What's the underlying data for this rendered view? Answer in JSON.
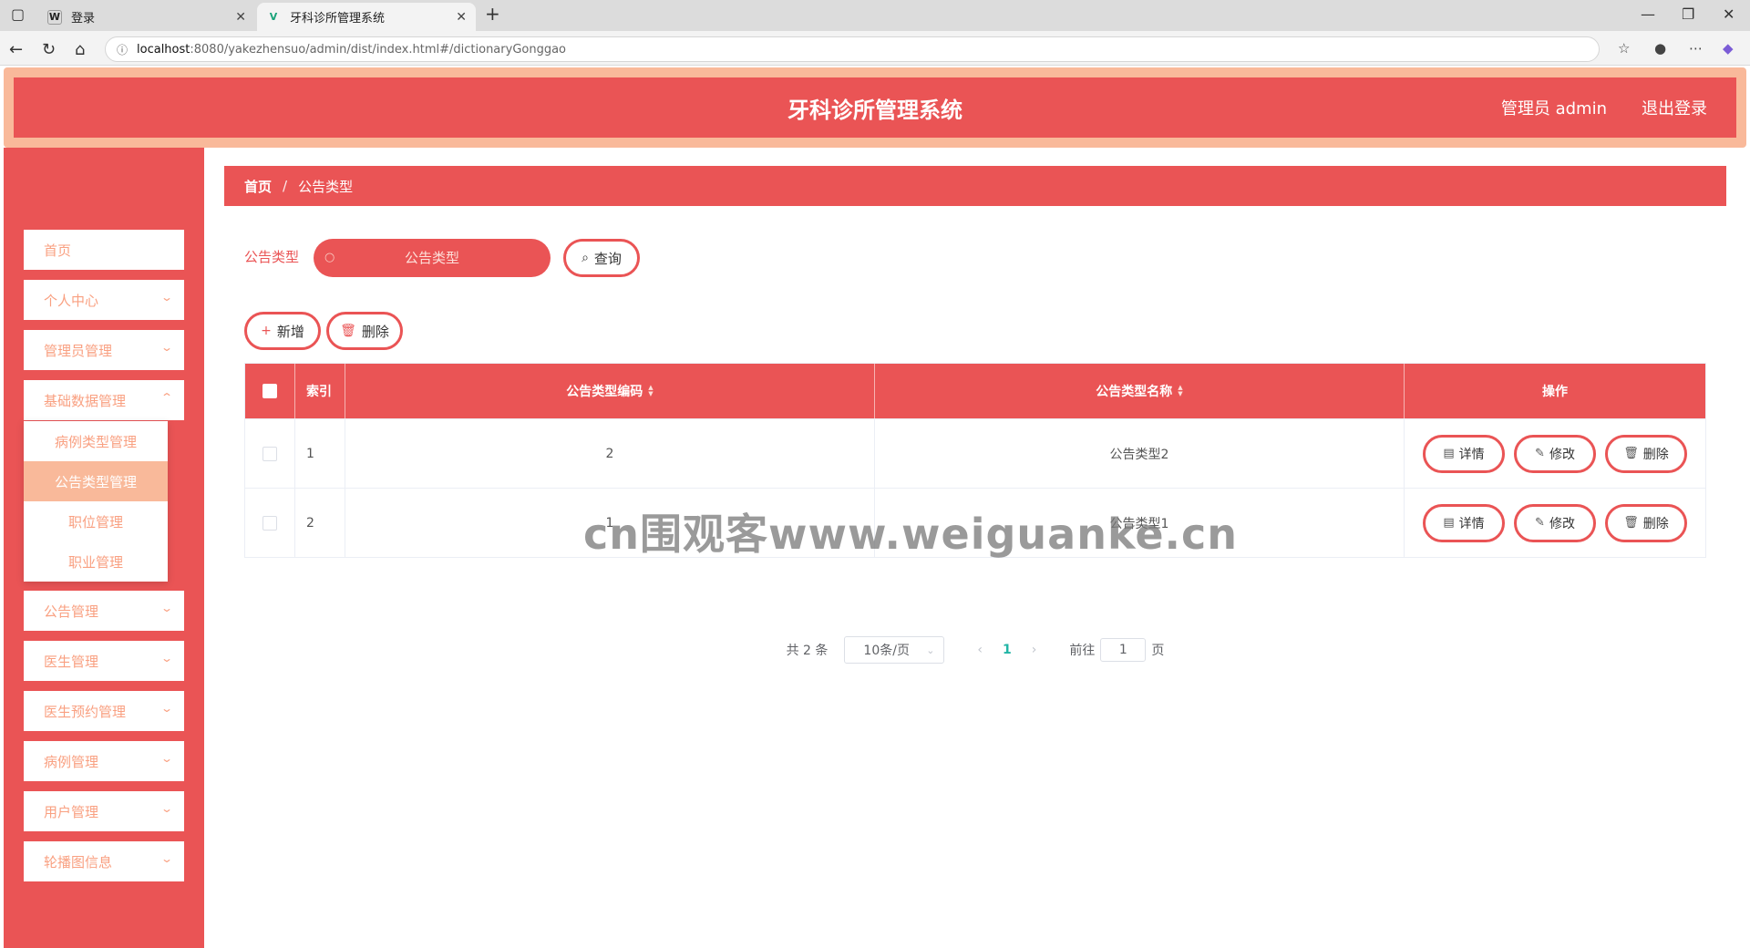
{
  "browser": {
    "tabs": [
      {
        "favicon": "W",
        "title": "登录",
        "active": false
      },
      {
        "favicon": "V",
        "title": "牙科诊所管理系统",
        "active": true
      }
    ],
    "url_host": "localhost",
    "url_path": ":8080/yakezhensuo/admin/dist/index.html#/dictionaryGonggao"
  },
  "header": {
    "title": "牙科诊所管理系统",
    "user": "管理员 admin",
    "logout": "退出登录"
  },
  "sidebar": {
    "items": [
      {
        "label": "首页"
      },
      {
        "label": "个人中心"
      },
      {
        "label": "管理员管理"
      },
      {
        "label": "基础数据管理"
      },
      {
        "label": "公告管理"
      },
      {
        "label": "医生管理"
      },
      {
        "label": "医生预约管理"
      },
      {
        "label": "病例管理"
      },
      {
        "label": "用户管理"
      },
      {
        "label": "轮播图信息"
      }
    ],
    "submenu": [
      {
        "label": "病例类型管理"
      },
      {
        "label": "公告类型管理"
      },
      {
        "label": "职位管理"
      },
      {
        "label": "职业管理"
      }
    ]
  },
  "breadcrumb": {
    "home": "首页",
    "separator": "/",
    "current": "公告类型"
  },
  "search": {
    "label": "公告类型",
    "placeholder": "公告类型",
    "button": "查询"
  },
  "actions": {
    "add": "新增",
    "delete": "删除"
  },
  "table": {
    "headers": {
      "index": "索引",
      "code": "公告类型编码",
      "name": "公告类型名称",
      "ops": "操作"
    },
    "rows": [
      {
        "index": "1",
        "code": "2",
        "name": "公告类型2"
      },
      {
        "index": "2",
        "code": "1",
        "name": "公告类型1"
      }
    ],
    "op_labels": {
      "detail": "详情",
      "edit": "修改",
      "delete": "删除"
    }
  },
  "pagination": {
    "total": "共 2 条",
    "page_size": "10条/页",
    "current_page": "1",
    "goto_label": "前往",
    "goto_value": "1",
    "page_suffix": "页"
  },
  "watermark": "cn围观客www.weiguanke.cn",
  "colors": {
    "primary": "#ea5455",
    "accent": "#f9b99a",
    "menu_text": "#f9a081"
  }
}
